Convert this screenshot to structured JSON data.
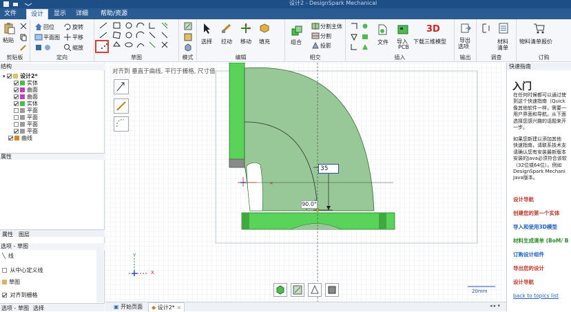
{
  "window": {
    "title": "设计2 - DesignSpark Mechanical"
  },
  "menu": {
    "file": "文件",
    "tabs": [
      "设计",
      "显示",
      "详细",
      "帮助/资源"
    ]
  },
  "ribbon": {
    "clipboard": {
      "paste": "粘贴",
      "label": "剪贴板"
    },
    "orient": {
      "home": "回位",
      "plan": "平面图",
      "rotate": "旋转",
      "pan": "平移",
      "zoom": "缩放",
      "label": "定向"
    },
    "sketch": {
      "label": "草图"
    },
    "mode": {
      "label": "模式"
    },
    "edit": {
      "select": "选择",
      "pull": "拉动",
      "move": "移动",
      "fill": "填充",
      "label": "编辑"
    },
    "intersect": {
      "combine": "组合",
      "split_body": "分割主体",
      "split": "分割",
      "project": "投影",
      "label": "相交"
    },
    "insert": {
      "file": "文件",
      "import_pcb": "导入",
      "pcb": "PCB",
      "download_3d": "下载三维模型",
      "label": "插入"
    },
    "output": {
      "export": "导出",
      "options": "选项",
      "label": "输出"
    },
    "investigate": {
      "material": "材料",
      "bom": "清单",
      "label": "调查"
    },
    "order": {
      "bom_quote": "物料清单报价",
      "label": "订购"
    }
  },
  "structure": {
    "header": "结构",
    "root": "设计2*",
    "items": [
      {
        "label": "实体",
        "checked": true,
        "color": "#4bbd4b"
      },
      {
        "label": "曲面",
        "checked": true,
        "color": "#c43ac4"
      },
      {
        "label": "曲面",
        "checked": true,
        "color": "#c43ac4"
      },
      {
        "label": "实体",
        "checked": true,
        "color": "#4bbd4b"
      },
      {
        "label": "平面",
        "checked": false,
        "color": "#9b9b9b"
      },
      {
        "label": "平面",
        "checked": false,
        "color": "#9b9b9b"
      },
      {
        "label": "平面",
        "checked": false,
        "color": "#9b9b9b"
      },
      {
        "label": "平面",
        "checked": true,
        "color": "#9b9b9b"
      },
      {
        "label": "曲线",
        "checked": true,
        "color": "#d08a20"
      }
    ]
  },
  "properties": {
    "header": "属性",
    "tab1": "属性",
    "tab2": "图层"
  },
  "options": {
    "header": "选项 - 草图",
    "line": "线",
    "from_center": "从中心定义线",
    "grid_label": "草图",
    "snap_to_grid": "对齐到栅格"
  },
  "bottom_left": {
    "tab1": "选项 - 草图",
    "tab2": "选择"
  },
  "canvas": {
    "hint": "对齐到 垂直于曲线, 平行于栅格, 尺寸值",
    "dim_value": "35",
    "angle_value": "90.0°",
    "scale_label": "20mm",
    "axis_x": "X",
    "axis_y": "Y"
  },
  "doc_tabs": {
    "start": "开始页面",
    "design": "设计2*"
  },
  "quick_start": {
    "header": "快速指南",
    "title": "入门",
    "para1": [
      "在任何时候都可以通过使",
      "到这个快速指南（Quick",
      "像其他软件一样，需要一",
      "用户界面和导航。从下面",
      "选择您感兴趣的话题来开",
      "一步。"
    ],
    "para2": [
      "如果您新建以添加其他",
      "快速指南，请联系技术支",
      "请确认您有安装最新版本",
      "安装的Java必须符合该软",
      "（32位或64位）。例如",
      "DesignSpark  Mechani",
      "Java版本。"
    ],
    "links": [
      {
        "text": "设计导航",
        "color": "#c0392b"
      },
      {
        "text": "创建您的第一个实体",
        "color": "#c0392b"
      },
      {
        "text": "导入和使用3D模型",
        "color": "#1f5fbf"
      },
      {
        "text": "材料生成清单 (BoM/ B",
        "color": "#2a8a2a"
      },
      {
        "text": "订购设计组件",
        "color": "#1f5fbf"
      },
      {
        "text": "导出您的设计",
        "color": "#c0392b"
      }
    ],
    "section": "设计导航",
    "back": "back to topics list"
  }
}
